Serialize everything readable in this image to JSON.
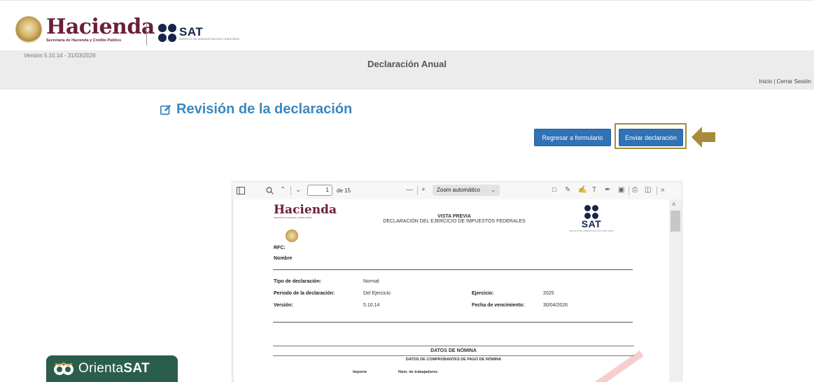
{
  "header": {
    "hacienda_name": "Hacienda",
    "hacienda_subtitle": "Secretaría de Hacienda y Crédito Público",
    "sat_name": "SAT",
    "sat_subtitle": "SERVICIO DE ADMINISTRACIÓN TRIBUTARIA"
  },
  "bar": {
    "version": "Versión 5.10.14 - 31/03/2026",
    "title": "Declaración Anual",
    "inicio": "Inicio",
    "separator": "|",
    "cerrar_sesion": "Cerrar Sesión"
  },
  "main": {
    "title": "Revisión de la declaración",
    "back_button": "Regresar a formulario",
    "send_button": "Enviar declaración"
  },
  "viewer": {
    "page_number": "1",
    "page_of": "de 15",
    "zoom": "Zoom automático",
    "document": {
      "logo_text": "Hacienda",
      "logo_sub": "Secretaría de Hacienda y Crédito Público",
      "preview_label": "VISTA PREVIA",
      "doc_title": "DECLARACIÓN DEL EJERCICIO DE IMPUESTOS FEDERALES",
      "sat_text": "SAT",
      "sat_sub": "SERVICIO DE ADMINISTRACIÓN TRIBUTARIA",
      "rfc_label": "RFC:",
      "nombre_label": "Nombre",
      "tipo_label": "Tipo de declaración:",
      "tipo_value": "Normal",
      "periodo_label": "Periodo de la declaración:",
      "periodo_value": "Del Ejercicio",
      "ejercicio_label": "Ejercicio:",
      "ejercicio_value": "2025",
      "version_label": "Versión:",
      "version_value": "5.10.14",
      "vencimiento_label": "Fecha de vencimiento:",
      "vencimiento_value": "30/04/2026",
      "section_title": "DATOS DE NÓMINA",
      "section_subtitle": "DATOS DE COMPROBANTES DE PAGO DE NÓMINA",
      "col_importe": "Importe",
      "col_trabajadores": "Núm. de trabajadores"
    }
  },
  "badge": {
    "orienta": "Orienta",
    "sat": "SAT"
  },
  "colors": {
    "hacienda_maroon": "#6b1e3a",
    "sat_navy": "#15264a",
    "title_blue": "#3a87c0",
    "button_blue": "#2f72b6",
    "highlight_gold": "#a88a3a",
    "badge_green": "#2b5d4c"
  }
}
